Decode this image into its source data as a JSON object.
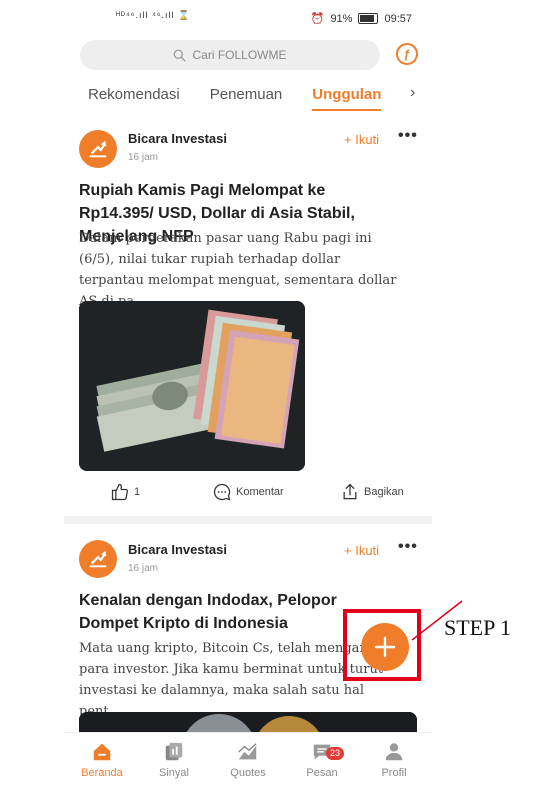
{
  "status_bar": {
    "left": "ᴴᴰ⁴⁶.ıll ⁴⁶.ıll ⌛",
    "battery": "91%",
    "time": "09:57"
  },
  "search": {
    "placeholder": "Cari FOLLOWME"
  },
  "tabs": [
    {
      "label": "Rekomendasi",
      "active": false
    },
    {
      "label": "Penemuan",
      "active": false
    },
    {
      "label": "Unggulan",
      "active": true
    }
  ],
  "tabs_more": "›",
  "posts": [
    {
      "author": "Bicara Investasi",
      "time": "16 jam",
      "follow": "+ Ikuti",
      "more": "•••",
      "title": "Rupiah Kamis Pagi Melompat ke Rp14.395/ USD, Dollar di Asia Stabil, Menjelang NFP",
      "summary": "Dalam pergerakan pasar uang Rabu pagi ini (6/5), nilai tukar rupiah terhadap dollar terpantau melompat menguat, sementara dollar AS di pa...",
      "likes": "1",
      "comment_label": "Komentar",
      "share_label": "Bagikan"
    },
    {
      "author": "Bicara Investasi",
      "time": "16 jam",
      "follow": "+ Ikuti",
      "more": "•••",
      "title": "Kenalan dengan Indodax, Pelopor Dompet Kripto di Indonesia",
      "summary": "Mata uang kripto, Bitcoin Cs, telah mengarah ke para investor. Jika kamu berminat untuk turut investasi ke dalamnya, maka salah satu hal pent..."
    }
  ],
  "bottom_nav": [
    {
      "label": "Beranda",
      "icon": "home-icon",
      "active": true
    },
    {
      "label": "Sinyal",
      "icon": "signal-icon",
      "active": false
    },
    {
      "label": "Quotes",
      "icon": "chart-icon",
      "active": false
    },
    {
      "label": "Pesan",
      "icon": "message-icon",
      "active": false,
      "badge": "23"
    },
    {
      "label": "Profil",
      "icon": "profile-icon",
      "active": false
    }
  ],
  "annotation": {
    "label": "STEP 1"
  },
  "colors": {
    "accent": "#f07d2a",
    "annotation": "#e3001b"
  }
}
